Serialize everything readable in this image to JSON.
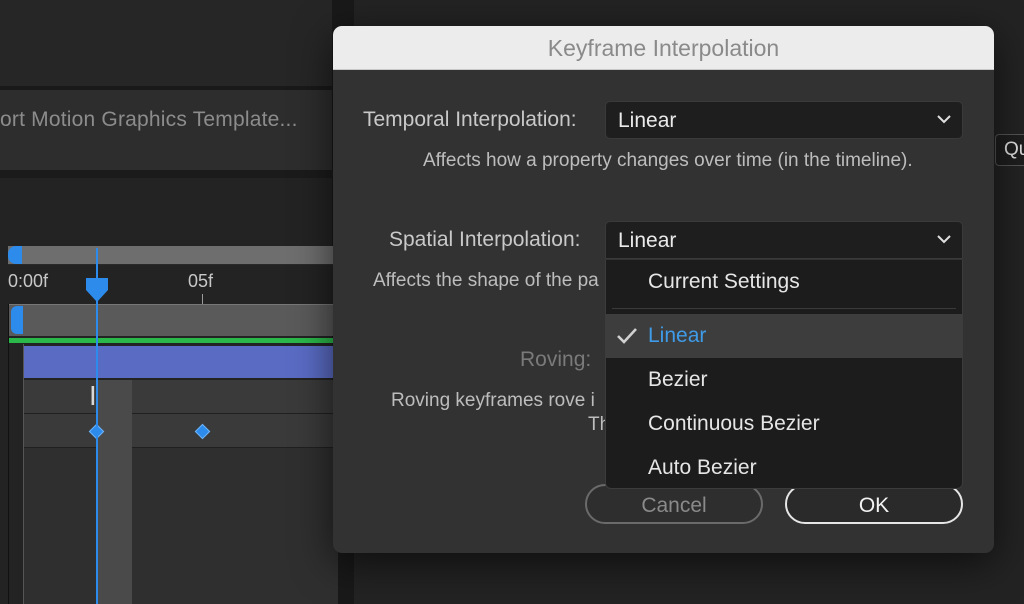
{
  "background": {
    "export_text": "ort Motion Graphics Template...",
    "ruler": {
      "start_label": "0:00f",
      "tick_label": "05f"
    },
    "quality_text": "Qu"
  },
  "dialog": {
    "title": "Keyframe Interpolation",
    "temporal": {
      "label": "Temporal Interpolation:",
      "value": "Linear",
      "description": "Affects how a property changes over time (in the timeline)."
    },
    "spatial": {
      "label": "Spatial Interpolation:",
      "value": "Linear",
      "description": "Affects the shape of the pa"
    },
    "roving": {
      "label": "Roving:",
      "description_line1": "Roving keyframes rove i",
      "description_line2": "Th"
    },
    "buttons": {
      "cancel": "Cancel",
      "ok": "OK"
    }
  },
  "spatial_menu": {
    "items": [
      {
        "label": "Current Settings",
        "selected": false
      },
      {
        "label": "Linear",
        "selected": true
      },
      {
        "label": "Bezier",
        "selected": false
      },
      {
        "label": "Continuous Bezier",
        "selected": false
      },
      {
        "label": "Auto Bezier",
        "selected": false
      }
    ]
  },
  "colors": {
    "accent_blue": "#2d8ceb",
    "selected_text_blue": "#3f9be8",
    "layer_bar": "#5a6bc4",
    "green_line": "#2bb84a"
  }
}
